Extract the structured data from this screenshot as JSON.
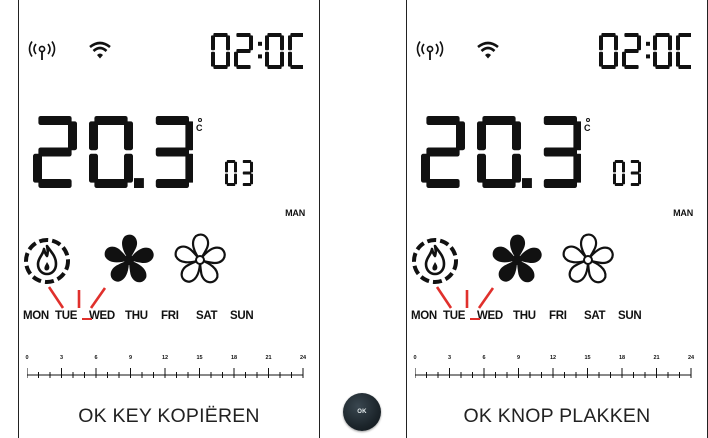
{
  "panels": [
    {
      "id": "left",
      "clock": "02:00",
      "temperature": "20,3",
      "unit": "°C",
      "small_value": "03",
      "mode": "MAN",
      "days": [
        "MON",
        "TUE",
        "WED",
        "THU",
        "FRI",
        "SAT",
        "SUN"
      ],
      "active_days": [
        "MON",
        "TUE",
        "WED"
      ],
      "ruler_labels": [
        "0",
        "3",
        "6",
        "9",
        "12",
        "15",
        "18",
        "21",
        "24"
      ],
      "caption": "OK KEY KOPIËREN"
    },
    {
      "id": "right",
      "clock": "02:00",
      "temperature": "20,3",
      "unit": "°C",
      "small_value": "03",
      "mode": "MAN",
      "days": [
        "MON",
        "TUE",
        "WED",
        "THU",
        "FRI",
        "SAT",
        "SUN"
      ],
      "active_days": [
        "MON",
        "TUE",
        "WED"
      ],
      "ruler_labels": [
        "0",
        "3",
        "6",
        "9",
        "12",
        "15",
        "18",
        "21",
        "24"
      ],
      "caption": "OK KNOP PLAKKEN"
    }
  ],
  "ok_button": {
    "label": "OK"
  },
  "icons": [
    "signal-icon",
    "wifi-icon",
    "flame-icon",
    "fan-icon",
    "fan-outline-icon"
  ],
  "colors": {
    "segment": "#111111",
    "highlight": "#e0302c",
    "ok_button": "#1c252b"
  }
}
